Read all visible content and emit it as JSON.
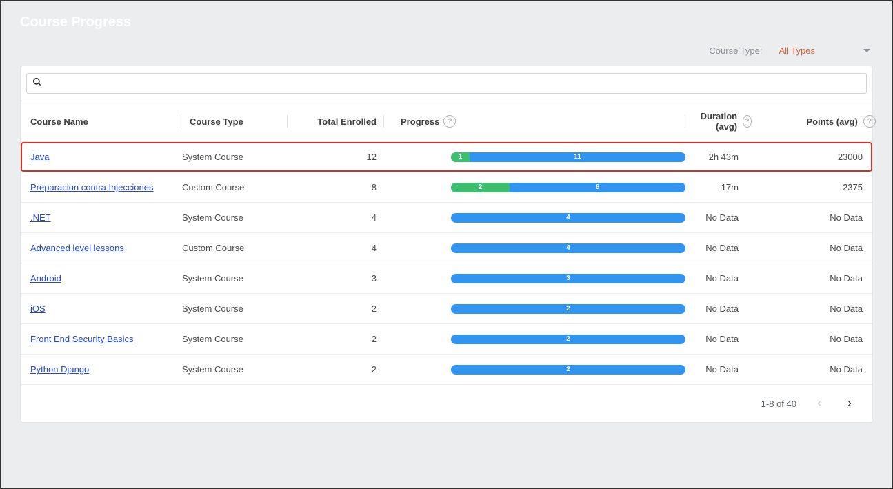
{
  "page": {
    "title": "Course Progress"
  },
  "filter": {
    "label": "Course Type:",
    "value": "All Types"
  },
  "search": {
    "placeholder": ""
  },
  "columns": {
    "name": "Course Name",
    "type": "Course Type",
    "enrolled": "Total Enrolled",
    "progress": "Progress",
    "duration": "Duration (avg)",
    "points": "Points (avg)"
  },
  "help_glyph": "?",
  "rows": [
    {
      "name": "Java",
      "type": "System Course",
      "enrolled": "12",
      "green": "1",
      "blue": "11",
      "greenPct": 8,
      "duration": "2h 43m",
      "points": "23000",
      "highlight": true
    },
    {
      "name": "Preparacion contra Injecciones",
      "type": "Custom Course",
      "enrolled": "8",
      "green": "2",
      "blue": "6",
      "greenPct": 25,
      "duration": "17m",
      "points": "2375"
    },
    {
      "name": ".NET",
      "type": "System Course",
      "enrolled": "4",
      "green": "",
      "blue": "4",
      "greenPct": 0,
      "duration": "No Data",
      "points": "No Data"
    },
    {
      "name": "Advanced level lessons",
      "type": "Custom Course",
      "enrolled": "4",
      "green": "",
      "blue": "4",
      "greenPct": 0,
      "duration": "No Data",
      "points": "No Data"
    },
    {
      "name": "Android",
      "type": "System Course",
      "enrolled": "3",
      "green": "",
      "blue": "3",
      "greenPct": 0,
      "duration": "No Data",
      "points": "No Data"
    },
    {
      "name": "iOS",
      "type": "System Course",
      "enrolled": "2",
      "green": "",
      "blue": "2",
      "greenPct": 0,
      "duration": "No Data",
      "points": "No Data"
    },
    {
      "name": "Front End Security Basics",
      "type": "System Course",
      "enrolled": "2",
      "green": "",
      "blue": "2",
      "greenPct": 0,
      "duration": "No Data",
      "points": "No Data"
    },
    {
      "name": "Python Django",
      "type": "System Course",
      "enrolled": "2",
      "green": "",
      "blue": "2",
      "greenPct": 0,
      "duration": "No Data",
      "points": "No Data"
    }
  ],
  "pager": {
    "text": "1-8 of 40"
  }
}
